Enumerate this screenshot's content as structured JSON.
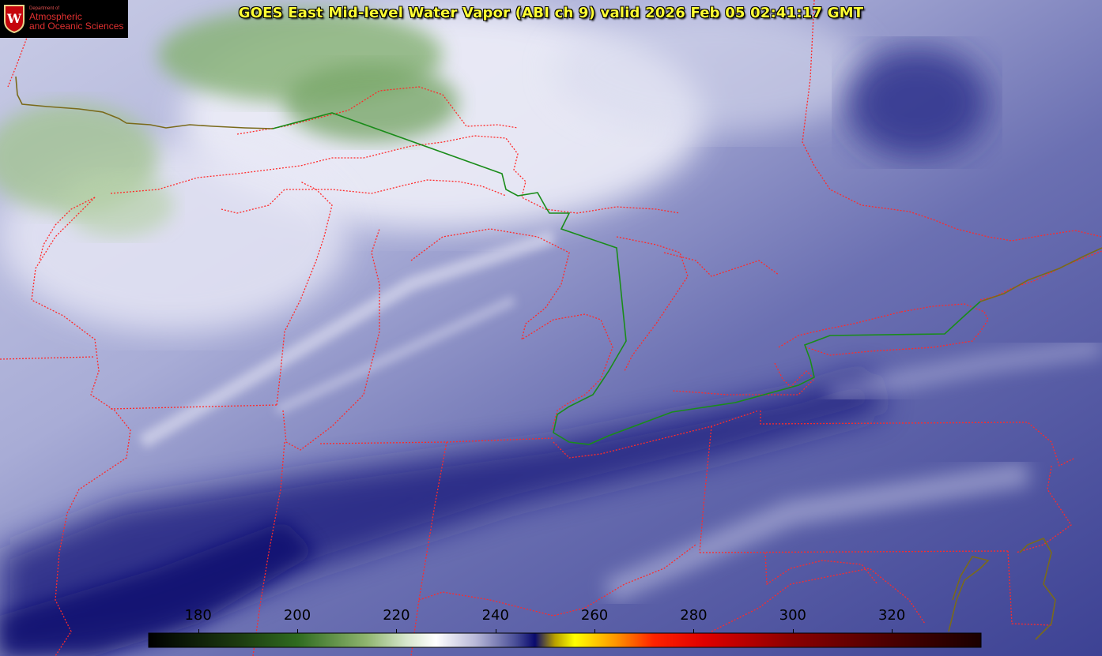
{
  "title": "GOES East Mid-level Water Vapor (ABI ch 9)  valid 2026 Feb 05 02:41:17 GMT",
  "logo": {
    "department": "Department of",
    "line1": "Atmospheric",
    "line2": "and Oceanic Sciences",
    "crest_letter": "W"
  },
  "colorbar": {
    "min": 170,
    "max": 338,
    "ticks": [
      180,
      200,
      220,
      240,
      260,
      280,
      300,
      320
    ],
    "stops": [
      {
        "value": 170,
        "color": "#000000"
      },
      {
        "value": 188,
        "color": "#1c3a10"
      },
      {
        "value": 200,
        "color": "#2f6b1f"
      },
      {
        "value": 214,
        "color": "#8fb56f"
      },
      {
        "value": 222,
        "color": "#d6e6cc"
      },
      {
        "value": 228,
        "color": "#ffffff"
      },
      {
        "value": 236,
        "color": "#b8b8d8"
      },
      {
        "value": 244,
        "color": "#4a4f98"
      },
      {
        "value": 248,
        "color": "#0a0a6e"
      },
      {
        "value": 252,
        "color": "#b8a000"
      },
      {
        "value": 256,
        "color": "#ffff00"
      },
      {
        "value": 264,
        "color": "#ff9900"
      },
      {
        "value": 272,
        "color": "#ff2200"
      },
      {
        "value": 282,
        "color": "#e00000"
      },
      {
        "value": 300,
        "color": "#8a0000"
      },
      {
        "value": 320,
        "color": "#4a0000"
      },
      {
        "value": 338,
        "color": "#1a0000"
      }
    ]
  },
  "colors": {
    "boundary_state": "#ff2a2a",
    "boundary_international": "#1a8c1a",
    "coastline": "#7a6a1a"
  }
}
